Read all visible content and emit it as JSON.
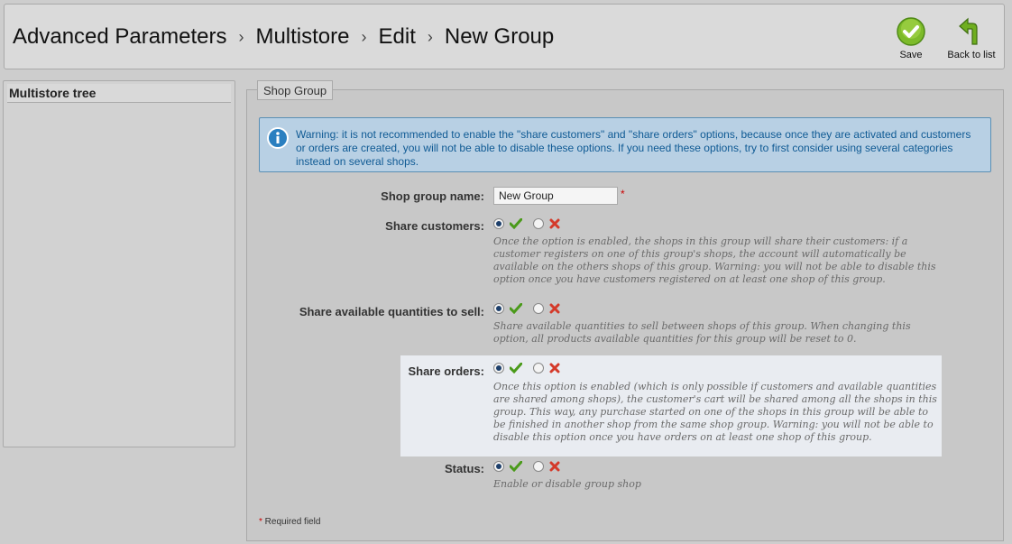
{
  "breadcrumb": {
    "items": [
      "Advanced Parameters",
      "Multistore",
      "Edit",
      "New Group"
    ],
    "separator": "›"
  },
  "toolbar": {
    "save_label": "Save",
    "back_label": "Back to list"
  },
  "sidebar": {
    "title": "Multistore tree"
  },
  "form": {
    "legend": "Shop Group",
    "warning": "Warning: it is not recommended to enable the \"share customers\" and \"share orders\" options, because once they are activated and customers or orders are created, you will not be able to disable these options. If you need these options, try to first consider using several categories instead on several shops.",
    "shop_group_name": {
      "label": "Shop group name:",
      "value": "New Group",
      "required_mark": "*"
    },
    "share_customers": {
      "label": "Share customers:",
      "selected": "yes",
      "help": "Once the option is enabled, the shops in this group will share their customers: if a customer registers on one of this group's shops, the account will automatically be available on the others shops of this group. Warning: you will not be able to disable this option once you have customers registered on at least one shop of this group."
    },
    "share_quantities": {
      "label": "Share available quantities to sell:",
      "selected": "yes",
      "help": "Share available quantities to sell between shops of this group. When changing this option, all products available quantities for this group will be reset to 0."
    },
    "share_orders": {
      "label": "Share orders:",
      "selected": "yes",
      "help": "Once this option is enabled (which is only possible if customers and available quantities are shared among shops), the customer's cart will be shared among all the shops in this group. This way, any purchase started on one of the shops in this group will be able to be finished in another shop from the same shop group. Warning: you will not be able to disable this option once you have orders on at least one shop of this group."
    },
    "status": {
      "label": "Status:",
      "selected": "yes",
      "help": "Enable or disable group shop"
    },
    "required_note": {
      "star": "*",
      "text": " Required field"
    }
  },
  "colors": {
    "yes_icon": "#4a9a1a",
    "no_icon": "#d43a2a",
    "info_blue": "#0f5a94"
  }
}
